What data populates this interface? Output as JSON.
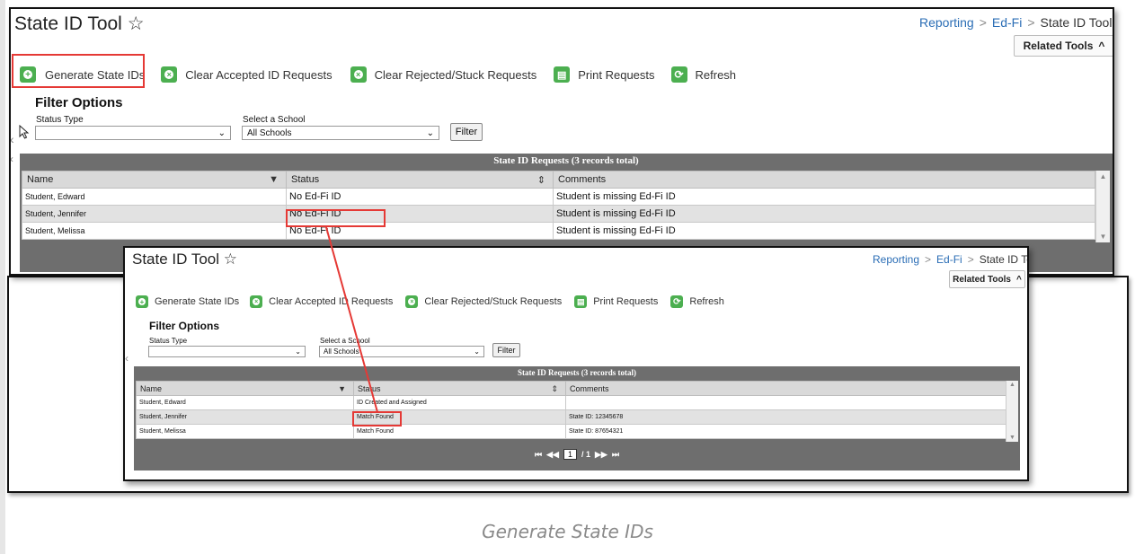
{
  "screen1": {
    "title": "State ID Tool",
    "star": "☆",
    "breadcrumb": [
      "Reporting",
      "Ed-Fi",
      "State ID Tool"
    ],
    "related_tools": "Related Tools",
    "toolbar": [
      {
        "label": "Generate State IDs",
        "icon": "plus-circle-icon"
      },
      {
        "label": "Clear Accepted ID Requests",
        "icon": "x-circle-icon"
      },
      {
        "label": "Clear Rejected/Stuck Requests",
        "icon": "x-circle-icon"
      },
      {
        "label": "Print Requests",
        "icon": "printer-icon"
      },
      {
        "label": "Refresh",
        "icon": "refresh-icon"
      }
    ],
    "filter_title": "Filter Options",
    "status_type_label": "Status Type",
    "status_type_value": "",
    "school_label": "Select a School",
    "school_value": "All Schools",
    "filter_button": "Filter",
    "grid_title": "State ID Requests (3 records total)",
    "columns": [
      "Name",
      "Status",
      "Comments"
    ],
    "rows": [
      {
        "name": "Student, Edward",
        "status": "No Ed-Fi ID",
        "comments": "Student is missing Ed-Fi ID"
      },
      {
        "name": "Student, Jennifer",
        "status": "No Ed-Fi ID",
        "comments": "Student is missing Ed-Fi ID"
      },
      {
        "name": "Student, Melissa",
        "status": "No Ed-Fi ID",
        "comments": "Student is missing Ed-Fi ID"
      }
    ]
  },
  "screen2": {
    "title": "State ID Tool",
    "star": "☆",
    "breadcrumb": [
      "Reporting",
      "Ed-Fi",
      "State ID Tool"
    ],
    "related_tools": "Related Tools",
    "toolbar": [
      {
        "label": "Generate State IDs",
        "icon": "plus-circle-icon"
      },
      {
        "label": "Clear Accepted ID Requests",
        "icon": "x-circle-icon"
      },
      {
        "label": "Clear Rejected/Stuck Requests",
        "icon": "x-circle-icon"
      },
      {
        "label": "Print Requests",
        "icon": "printer-icon"
      },
      {
        "label": "Refresh",
        "icon": "refresh-icon"
      }
    ],
    "filter_title": "Filter Options",
    "status_type_label": "Status Type",
    "status_type_value": "",
    "school_label": "Select a School",
    "school_value": "All Schools",
    "filter_button": "Filter",
    "grid_title": "State ID Requests (3 records total)",
    "columns": [
      "Name",
      "Status",
      "Comments"
    ],
    "rows": [
      {
        "name": "Student, Edward",
        "status": "ID Created and Assigned",
        "comments": ""
      },
      {
        "name": "Student, Jennifer",
        "status": "Match Found",
        "comments": "State ID: 12345678"
      },
      {
        "name": "Student, Melissa",
        "status": "Match Found",
        "comments": "State ID: 87654321"
      }
    ],
    "pager": {
      "current": "1",
      "total": "/ 1"
    }
  },
  "caption": "Generate State IDs",
  "colors": {
    "highlight": "#e53935",
    "link": "#2a6db5",
    "icon_green": "#4caf50",
    "grid_header": "#6e6e6e"
  }
}
